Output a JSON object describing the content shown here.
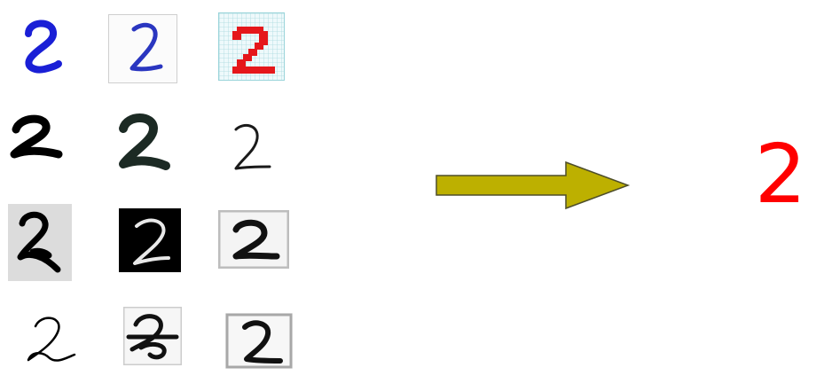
{
  "result": {
    "label": "2",
    "color": "#ff0000"
  },
  "arrow": {
    "fill": "#bdb000",
    "stroke": "#4e4e2a"
  }
}
